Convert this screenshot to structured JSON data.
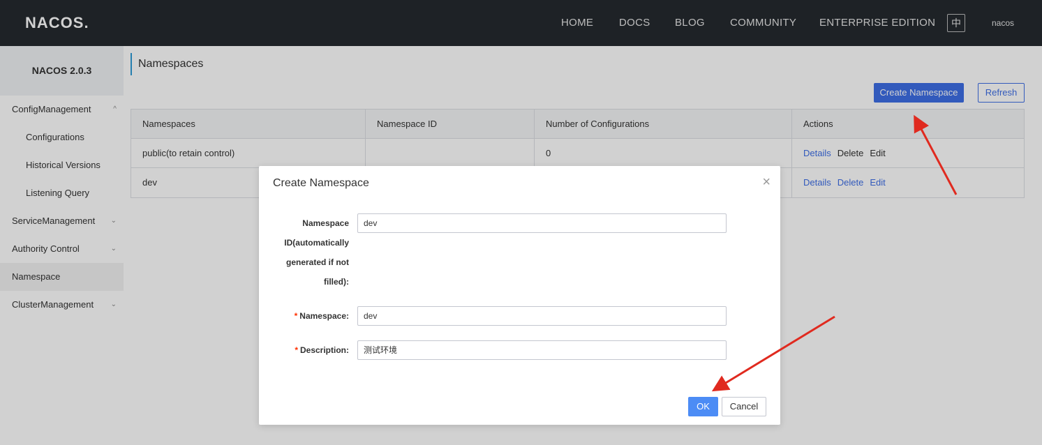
{
  "topbar": {
    "logo_text_a": "NA",
    "logo_text_b": "COS",
    "logo_dot": ".",
    "nav": [
      "HOME",
      "DOCS",
      "BLOG",
      "COMMUNITY",
      "ENTERPRISE EDITION"
    ],
    "lang_button": "中",
    "user": "nacos"
  },
  "sidebar": {
    "version": "NACOS 2.0.3",
    "items": [
      {
        "label": "ConfigManagement",
        "chevron": "^"
      },
      {
        "label": "Configurations"
      },
      {
        "label": "Historical Versions"
      },
      {
        "label": "Listening Query"
      },
      {
        "label": "ServiceManagement",
        "chevron": "⌄"
      },
      {
        "label": "Authority Control",
        "chevron": "⌄"
      },
      {
        "label": "Namespace"
      },
      {
        "label": "ClusterManagement",
        "chevron": "⌄"
      }
    ]
  },
  "main": {
    "title": "Namespaces",
    "create_button": "Create Namespace",
    "refresh_button": "Refresh",
    "table": {
      "headers": [
        "Namespaces",
        "Namespace ID",
        "Number of Configurations",
        "Actions"
      ],
      "rows": [
        {
          "name": "public(to retain control)",
          "id": "",
          "count": "0",
          "actions": [
            "Details",
            "Delete",
            "Edit"
          ]
        },
        {
          "name": "dev",
          "id": "",
          "count": "",
          "actions": [
            "Details",
            "Delete",
            "Edit"
          ]
        }
      ]
    }
  },
  "dialog": {
    "title": "Create Namespace",
    "close": "×",
    "id_label_lines": [
      "Namespace",
      "ID(automatically",
      "generated if not",
      "filled):"
    ],
    "id_value": "dev",
    "required_mark": "*",
    "name_label": "Namespace:",
    "name_value": "dev",
    "desc_label": "Description:",
    "desc_value": "测试环境",
    "ok": "OK",
    "cancel": "Cancel"
  },
  "colors": {
    "topbar": "#252a2f",
    "primary": "#3e6ee6",
    "ok_button": "#4c8cf5",
    "annotation_arrow": "#e02a1f"
  }
}
